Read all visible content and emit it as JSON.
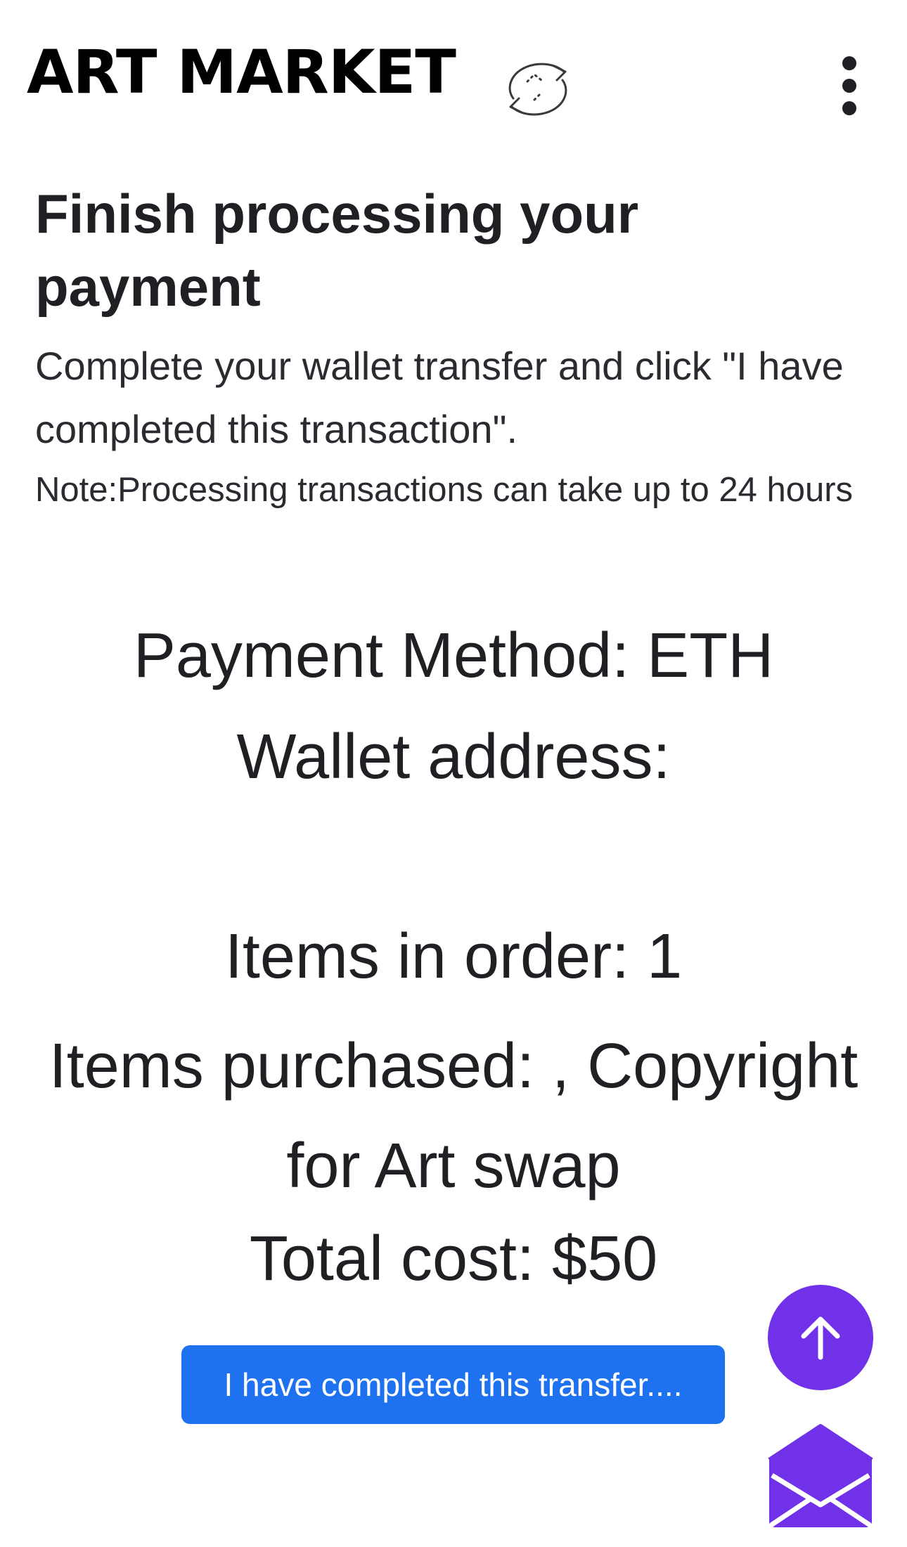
{
  "header": {
    "brand": "ART MARKET",
    "sync_icon": "sync-arrows-icon",
    "menu_icon": "kebab-menu-icon"
  },
  "main": {
    "heading": "Finish processing your payment",
    "intro": "Complete your wallet transfer and click \"I have completed this transaction\".",
    "note": "Note:Processing transactions can take up to 24 hours",
    "payment_method": "Payment Method: ETH",
    "wallet_label": "Wallet address:",
    "wallet_address": "",
    "items_count": "Items in order: 1",
    "items_purchased": "Items purchased: , Copyright for Art swap",
    "total_cost": "Total cost: $50",
    "confirm_button": "I have completed this transfer...."
  },
  "floating": {
    "scroll_top_icon": "arrow-up-icon",
    "mail_icon": "mail-icon"
  },
  "colors": {
    "accent_blue": "#1e72ef",
    "accent_purple": "#7131e8",
    "text": "#1f1f24"
  }
}
